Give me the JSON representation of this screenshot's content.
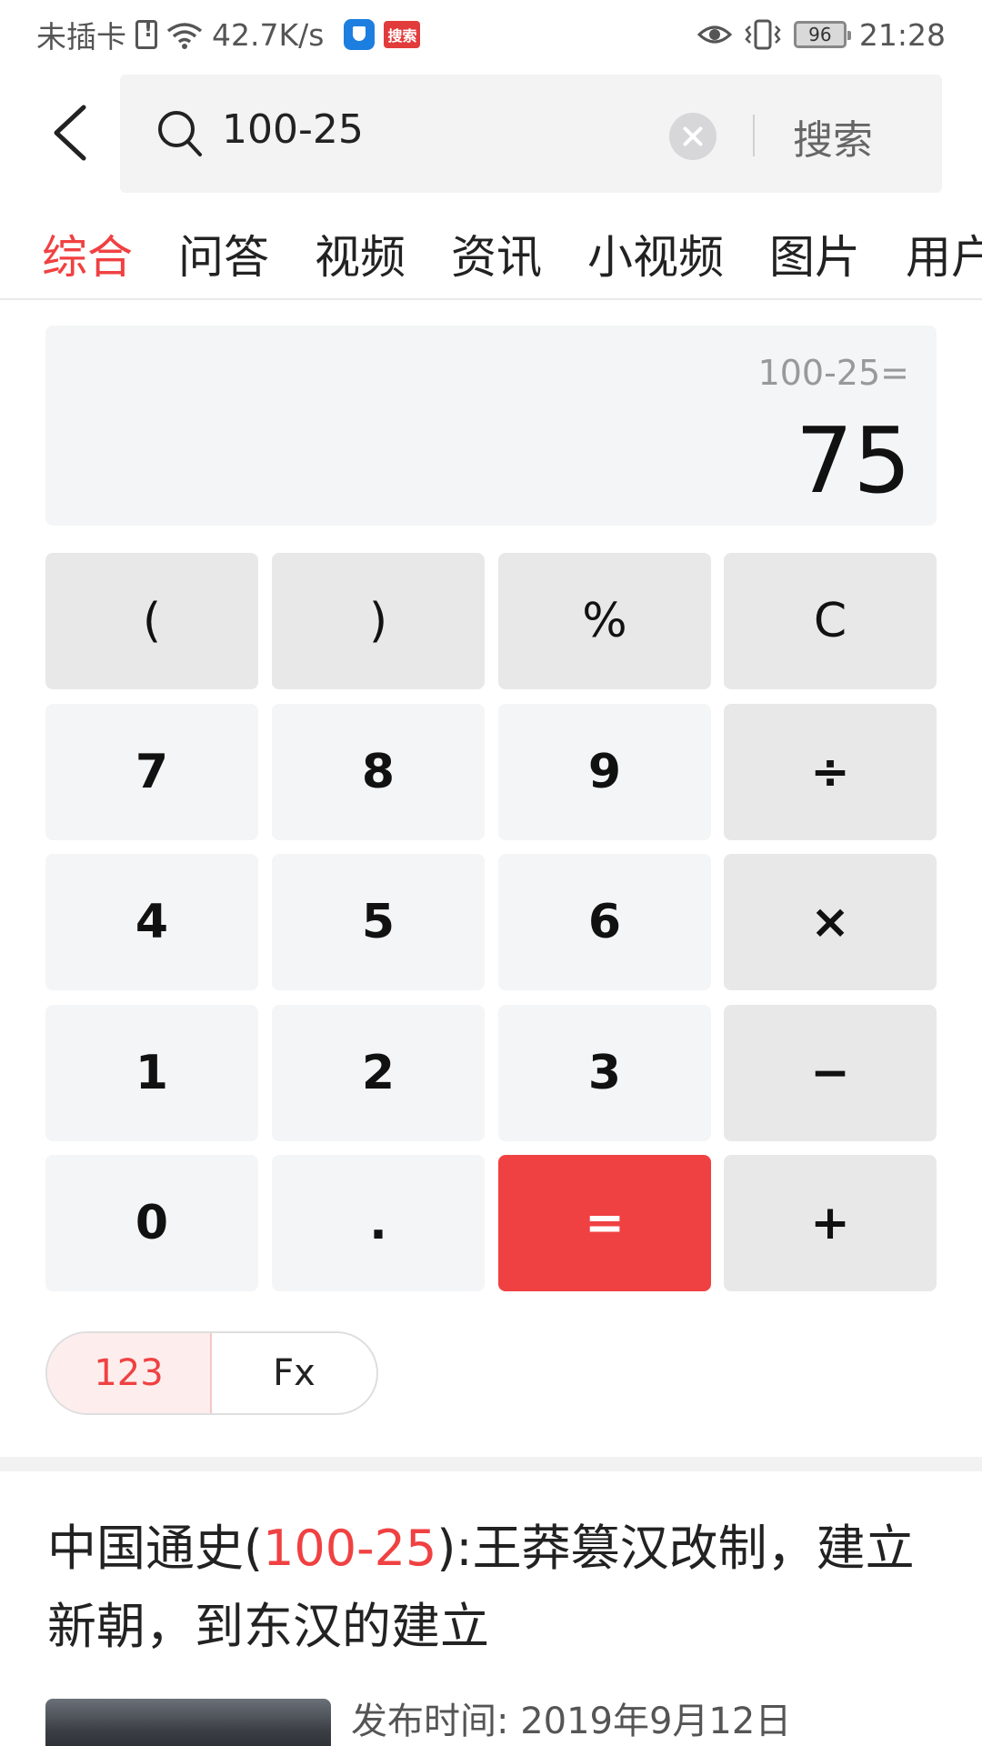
{
  "status_bar": {
    "carrier": "未插卡",
    "speed": "42.7K/s",
    "search_badge": "搜索",
    "battery": "96",
    "time": "21:28"
  },
  "search": {
    "query": "100-25",
    "search_button": "搜索"
  },
  "tabs": [
    "综合",
    "问答",
    "视频",
    "资讯",
    "小视频",
    "图片",
    "用户"
  ],
  "calculator": {
    "expression": "100-25=",
    "result": "75",
    "keys": [
      [
        "(",
        ")",
        "%",
        "C"
      ],
      [
        "7",
        "8",
        "9",
        "÷"
      ],
      [
        "4",
        "5",
        "6",
        "×"
      ],
      [
        "1",
        "2",
        "3",
        "−"
      ],
      [
        "0",
        ".",
        "=",
        "+"
      ]
    ],
    "modes": [
      "123",
      "Fx"
    ]
  },
  "article": {
    "title_prefix": "中国通史(",
    "title_highlight": "100-25",
    "title_suffix": "):王莽篡汉改制，建立新朝，到东汉的建立",
    "meta": "发布时间: 2019年9月12日"
  },
  "colors": {
    "accent": "#f04142",
    "display_bg": "#f4f5f6",
    "operator_bg": "#e8e8e8"
  }
}
